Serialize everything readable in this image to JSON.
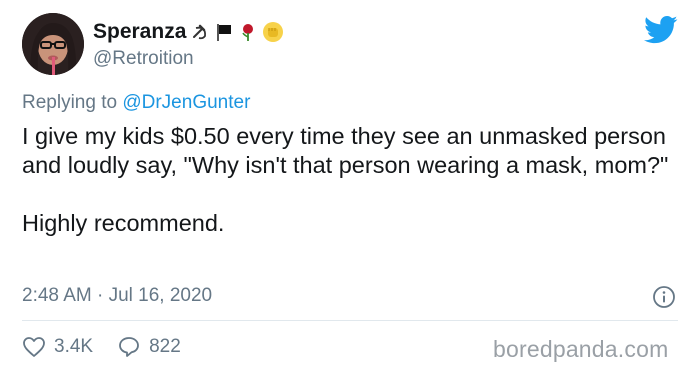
{
  "author": {
    "display_name": "Speranza",
    "handle": "@Retroition",
    "name_emojis": [
      "hammer-and-sickle",
      "black-flag",
      "rose",
      "raised-fist"
    ]
  },
  "reply": {
    "prefix": "Replying to ",
    "mention": "@DrJenGunter"
  },
  "tweet": {
    "paragraphs": [
      "I give my kids $0.50 every time they see an unmasked person and loudly say, \"Why isn't that person wearing a mask, mom?\"",
      "Highly recommend."
    ],
    "timestamp": "2:48 AM · Jul 16, 2020"
  },
  "actions": {
    "likes": "3.4K",
    "replies": "822"
  },
  "watermark": "boredpanda.com",
  "colors": {
    "twitter_blue": "#1da1f2",
    "mention_blue": "#1b95e0",
    "secondary_text": "#657786"
  },
  "icons": [
    "heart-icon",
    "reply-icon",
    "info-icon",
    "twitter-bird-icon"
  ]
}
